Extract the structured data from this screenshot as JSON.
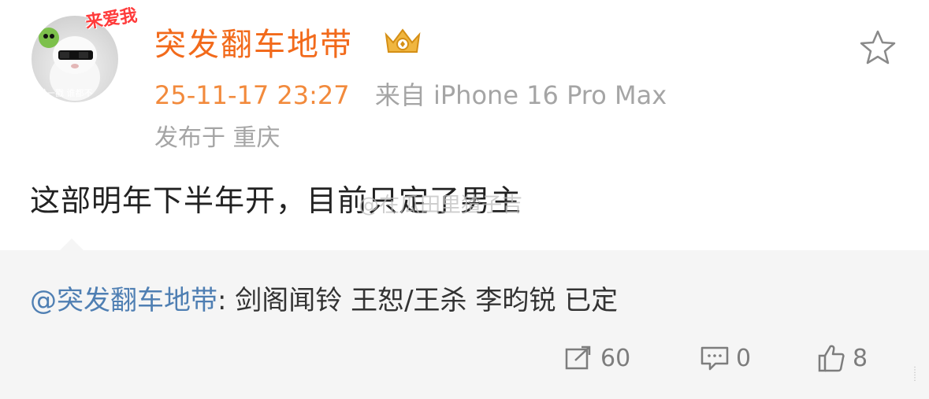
{
  "post": {
    "username": "突发翻车地带",
    "avatar_sticker_text": "来爱我",
    "avatar_caption": "横一戳 谁都不",
    "timestamp": "25-11-17 23:27",
    "source": "来自 iPhone 16 Pro Max",
    "location": "发布于 重庆",
    "content": "这部明年下半年开，目前只定了男主",
    "watermark": "@在瓜田里猹子吉"
  },
  "repost": {
    "author": "@突发翻车地带",
    "separator": ": ",
    "text": "剑阁闻铃 王恕/王杀 李昀锐 已定"
  },
  "actions": {
    "repost_count": "60",
    "comment_count": "0",
    "like_count": "8"
  },
  "colors": {
    "username": "#f26a1b",
    "timestamp": "#f28a3c",
    "meta": "#a5a5a5",
    "link": "#4f7fb3",
    "repost_bg": "#f5f5f5"
  },
  "icons": {
    "favorite": "star-icon",
    "repost": "share-icon",
    "comment": "comment-icon",
    "like": "thumbs-up-icon",
    "badge": "vip-crown-icon"
  }
}
